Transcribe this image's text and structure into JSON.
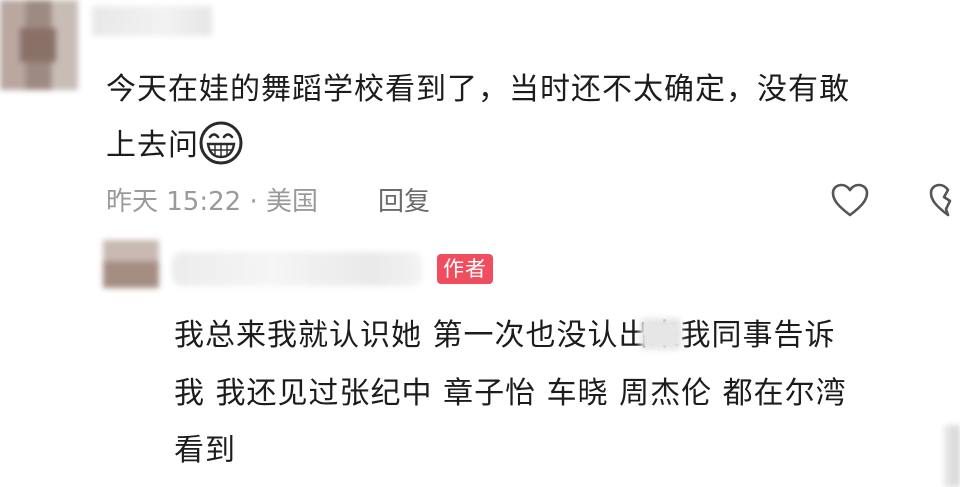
{
  "comment": {
    "text_line1": "今天在娃的舞蹈学校看到了，当时还不太确定，没有敢",
    "text_line2": "上去问",
    "emoji": "grinning-face",
    "meta": "昨天 15:22 · 美国",
    "reply_label": "回复"
  },
  "reply": {
    "author_badge": "作者",
    "line1": "我总来我就认识她 第一次也没认出来我同事告诉",
    "line2": "我 我还见过张纪中 章子怡 车晓 周杰伦 都在尔湾",
    "line3": "看到"
  },
  "colors": {
    "badge": "#f04e5e",
    "text": "#1c1c1c",
    "meta": "#9a9a9a"
  },
  "icons": [
    "like-heart-icon",
    "dislike-broken-heart-icon"
  ]
}
